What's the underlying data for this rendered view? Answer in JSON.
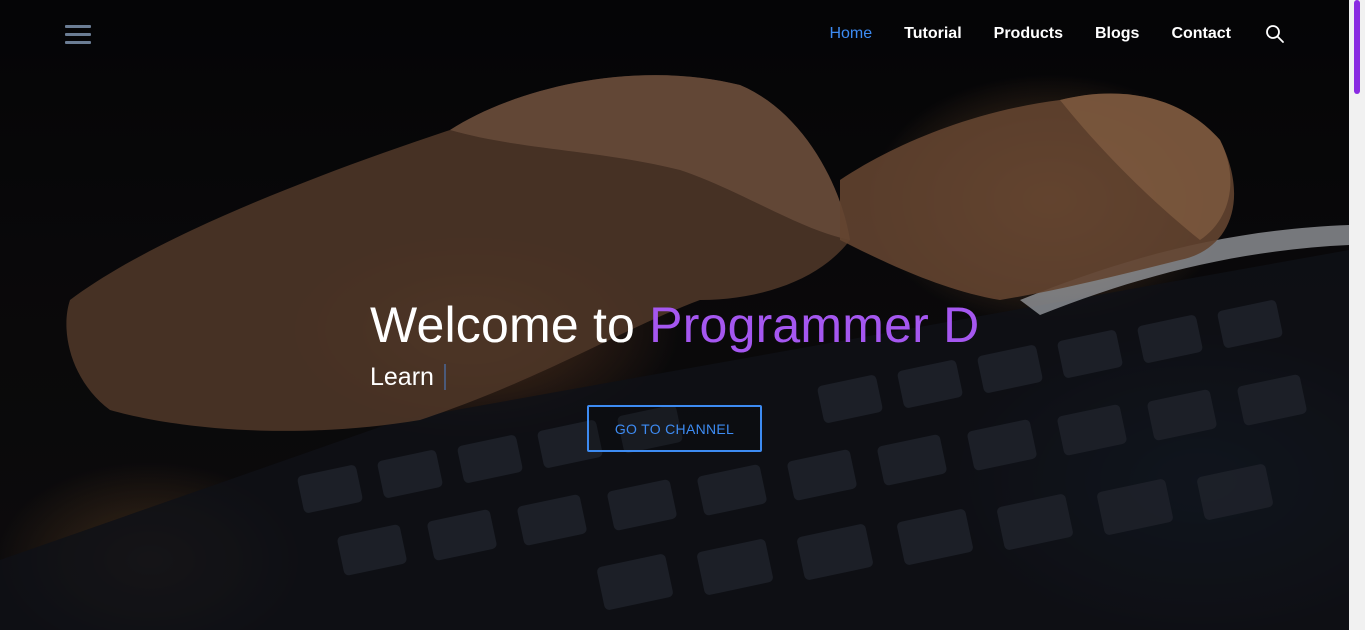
{
  "nav": {
    "links": [
      {
        "label": "Home",
        "active": true
      },
      {
        "label": "Tutorial",
        "active": false
      },
      {
        "label": "Products",
        "active": false
      },
      {
        "label": "Blogs",
        "active": false
      },
      {
        "label": "Contact",
        "active": false
      }
    ],
    "icons": {
      "menu": "hamburger-menu-icon",
      "search": "search-icon"
    }
  },
  "hero": {
    "title_prefix": "Welcome to ",
    "title_accent": "Programmer D",
    "subtitle": "Learn",
    "cta_label": "GO TO CHANNEL"
  },
  "colors": {
    "accent_blue": "#3d8bf2",
    "accent_purple": "#a557f0",
    "scroll_thumb": "#8a2be2"
  }
}
